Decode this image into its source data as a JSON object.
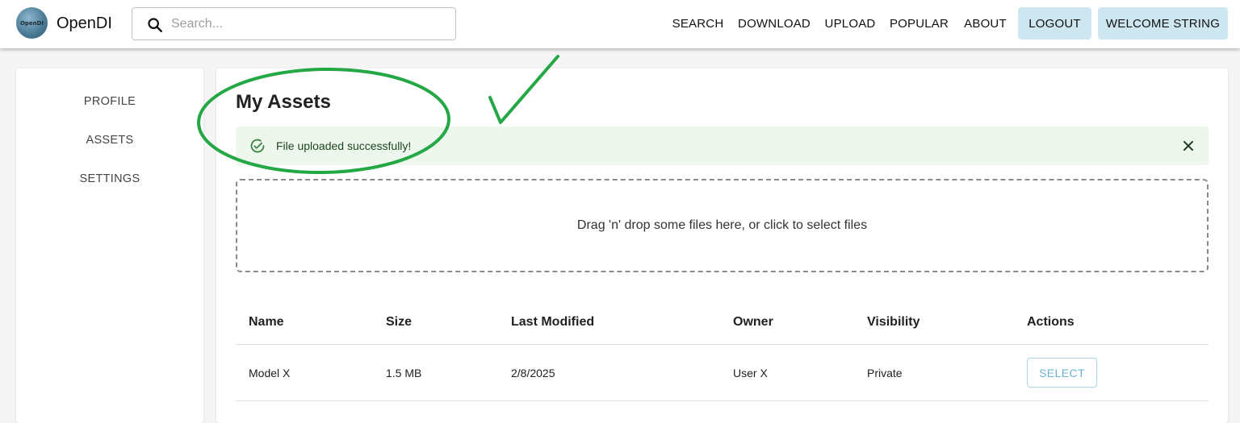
{
  "header": {
    "logo_text": "OpenDI",
    "brand": "OpenDI",
    "search_placeholder": "Search...",
    "nav": [
      "SEARCH",
      "DOWNLOAD",
      "UPLOAD",
      "POPULAR",
      "ABOUT"
    ],
    "logout_label": "LOGOUT",
    "welcome_label": "WELCOME STRING",
    "button_color": "#cde6f0"
  },
  "sidebar": {
    "items": [
      {
        "label": "PROFILE"
      },
      {
        "label": "ASSETS"
      },
      {
        "label": "SETTINGS"
      }
    ]
  },
  "main": {
    "title": "My Assets",
    "alert": {
      "message": "File uploaded successfully!",
      "icon": "check-circle-icon",
      "color": "#2e7d32",
      "background": "#edf7ed"
    },
    "dropzone_text": "Drag 'n' drop some files here, or click to select files",
    "table": {
      "columns": [
        "Name",
        "Size",
        "Last Modified",
        "Owner",
        "Visibility",
        "Actions"
      ],
      "rows": [
        {
          "name": "Model X",
          "size": "1.5 MB",
          "modified": "2/8/2025",
          "owner": "User X",
          "visibility": "Private",
          "action": "SELECT"
        }
      ]
    }
  },
  "annotation": {
    "color": "#23a845",
    "shapes": [
      "ellipse-around-alert",
      "checkmark"
    ]
  }
}
